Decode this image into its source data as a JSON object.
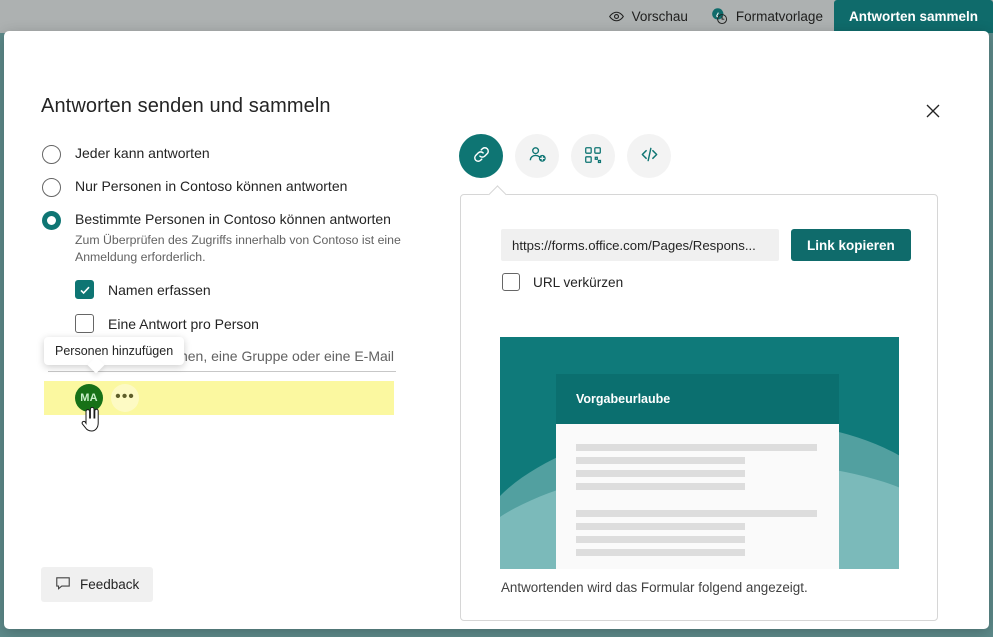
{
  "topbar": {
    "preview_label": "Vorschau",
    "preview_icon": "eye-icon",
    "style_label": "Formatvorlage",
    "style_icon": "paint-style-icon",
    "collect_label": "Antworten sammeln"
  },
  "dialog": {
    "title": "Antworten senden und sammeln",
    "close_icon": "close-icon"
  },
  "audience": {
    "options": [
      {
        "label": "Jeder kann antworten",
        "sub": "",
        "selected": false
      },
      {
        "label": "Nur Personen in Contoso können antworten",
        "sub": "",
        "selected": false
      },
      {
        "label": "Bestimmte Personen in Contoso können antworten",
        "sub": "Zum Überprüfen des Zugriffs innerhalb von Contoso ist eine Anmeldung erforderlich.",
        "selected": true
      }
    ],
    "checkboxes": [
      {
        "label": "Namen erfassen",
        "checked": true
      },
      {
        "label": "Eine Antwort pro Person",
        "checked": false
      }
    ],
    "people_input_placeholder": "Geben Sie einen Namen, eine Gruppe oder eine E-Mail-Adresse ein",
    "people_input_value": "",
    "tooltip_text": "Personen hinzufügen",
    "person": {
      "initials": "MA",
      "more_label": "•••",
      "avatar_color": "#177117",
      "row_highlight_color": "#fbf8a0"
    }
  },
  "feedback": {
    "label": "Feedback",
    "icon": "speech-bubble-icon"
  },
  "share": {
    "tabs": [
      {
        "name": "link-tab",
        "icon": "link-icon",
        "active": true
      },
      {
        "name": "invite-people-tab",
        "icon": "person-add-icon",
        "active": false
      },
      {
        "name": "qr-code-tab",
        "icon": "qr-code-icon",
        "active": false
      },
      {
        "name": "embed-code-tab",
        "icon": "code-icon",
        "active": false
      }
    ],
    "link_value": "https://forms.office.com/Pages/Respons...",
    "copy_label": "Link kopieren",
    "shorten_label": "URL verkürzen",
    "shorten_checked": false,
    "preview_form_title": "Vorgabeurlaube",
    "preview_caption": "Antwortenden wird das Formular folgend angezeigt."
  },
  "colors": {
    "accent_teal": "#0e7573",
    "button_teal": "#0f6b6b",
    "highlight_yellow": "#fbf8a0",
    "avatar_green": "#177117"
  }
}
